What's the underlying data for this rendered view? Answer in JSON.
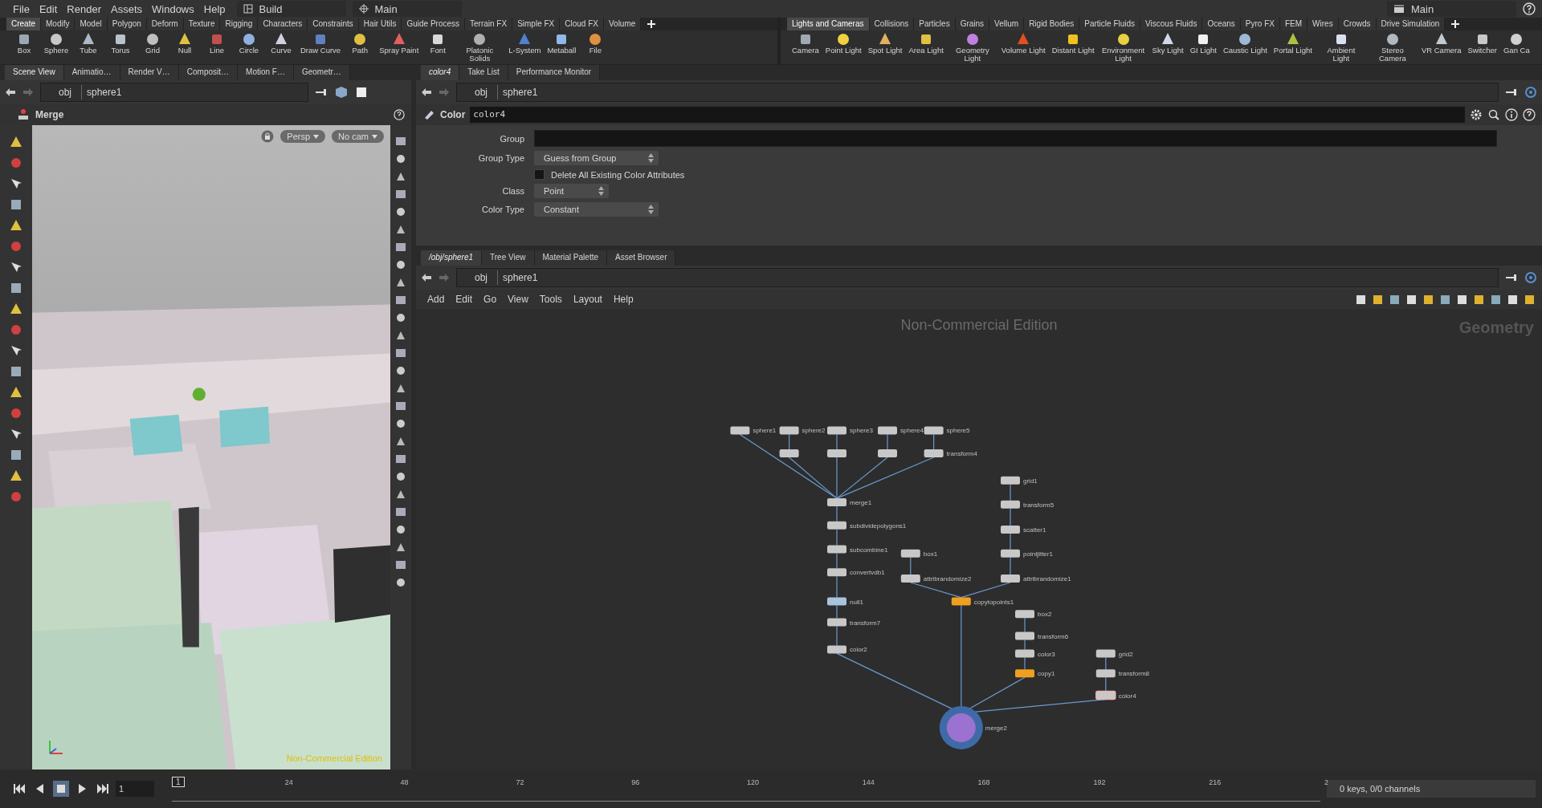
{
  "menu": [
    "File",
    "Edit",
    "Render",
    "Assets",
    "Windows",
    "Help"
  ],
  "desktop": "Build",
  "workspace": "Main",
  "right_workspace": "Main",
  "shelf_left": {
    "tabs": [
      {
        "label": "Create",
        "selected": true
      },
      {
        "label": "Modify",
        "selected": false
      },
      {
        "label": "Model",
        "selected": false
      },
      {
        "label": "Polygon",
        "selected": false
      },
      {
        "label": "Deform",
        "selected": false
      },
      {
        "label": "Texture",
        "selected": false
      },
      {
        "label": "Rigging",
        "selected": false
      },
      {
        "label": "Characters",
        "selected": false
      },
      {
        "label": "Constraints",
        "selected": false
      },
      {
        "label": "Hair Utils",
        "selected": false
      },
      {
        "label": "Guide Process",
        "selected": false
      },
      {
        "label": "Terrain FX",
        "selected": false
      },
      {
        "label": "Simple FX",
        "selected": false
      },
      {
        "label": "Cloud FX",
        "selected": false
      },
      {
        "label": "Volume",
        "selected": false
      }
    ],
    "tools": [
      "Box",
      "Sphere",
      "Tube",
      "Torus",
      "Grid",
      "Null",
      "Line",
      "Circle",
      "Curve",
      "Draw Curve",
      "Path",
      "Spray Paint",
      "Font",
      "Platonic Solids",
      "L-System",
      "Metaball",
      "File"
    ]
  },
  "shelf_right": {
    "tabs": [
      {
        "label": "Lights and Cameras",
        "selected": true
      },
      {
        "label": "Collisions",
        "selected": false
      },
      {
        "label": "Particles",
        "selected": false
      },
      {
        "label": "Grains",
        "selected": false
      },
      {
        "label": "Vellum",
        "selected": false
      },
      {
        "label": "Rigid Bodies",
        "selected": false
      },
      {
        "label": "Particle Fluids",
        "selected": false
      },
      {
        "label": "Viscous Fluids",
        "selected": false
      },
      {
        "label": "Oceans",
        "selected": false
      },
      {
        "label": "Pyro FX",
        "selected": false
      },
      {
        "label": "FEM",
        "selected": false
      },
      {
        "label": "Wires",
        "selected": false
      },
      {
        "label": "Crowds",
        "selected": false
      },
      {
        "label": "Drive Simulation",
        "selected": false
      }
    ],
    "tools": [
      "Camera",
      "Point Light",
      "Spot Light",
      "Area Light",
      "Geometry Light",
      "Volume Light",
      "Distant Light",
      "Environment Light",
      "Sky Light",
      "GI Light",
      "Caustic Light",
      "Portal Light",
      "Ambient Light",
      "Stereo Camera",
      "VR Camera",
      "Switcher",
      "Gan Ca"
    ]
  },
  "scene_pane": {
    "tabs": [
      {
        "label": "Scene View",
        "selected": true
      },
      {
        "label": "Animatio…",
        "selected": false
      },
      {
        "label": "Render V…",
        "selected": false
      },
      {
        "label": "Composit…",
        "selected": false
      },
      {
        "label": "Motion F…",
        "selected": false
      },
      {
        "label": "Geometr…",
        "selected": false
      }
    ],
    "path": [
      "obj",
      "sphere1"
    ],
    "tool": "Merge",
    "view_menu": "Persp",
    "camera_menu": "No cam",
    "watermark": "Non-Commercial Edition"
  },
  "parameter_pane": {
    "tabs": [
      {
        "label": "color4",
        "selected": true
      },
      {
        "label": "Take List",
        "selected": false
      },
      {
        "label": "Performance Monitor",
        "selected": false
      }
    ],
    "path": [
      "obj",
      "sphere1"
    ],
    "node_type": "Color",
    "node_name": "color4",
    "params": [
      {
        "kind": "field",
        "label": "Group"
      },
      {
        "kind": "dropdown",
        "label": "Group Type",
        "value": "Guess from Group"
      },
      {
        "kind": "checkbox",
        "label": "Delete All Existing Color Attributes",
        "checked": false
      },
      {
        "kind": "dropdown",
        "label": "Class",
        "value": "Point"
      },
      {
        "kind": "dropdown",
        "label": "Color Type",
        "value": "Constant"
      }
    ]
  },
  "network_pane": {
    "tabs": [
      {
        "label": "/obj/sphere1",
        "selected": true
      },
      {
        "label": "Tree View",
        "selected": false
      },
      {
        "label": "Material Palette",
        "selected": false
      },
      {
        "label": "Asset Browser",
        "selected": false
      }
    ],
    "path": [
      "obj",
      "sphere1"
    ],
    "menu": [
      "Add",
      "Edit",
      "Go",
      "View",
      "Tools",
      "Layout",
      "Help"
    ],
    "watermark": "Non-Commercial Edition",
    "context": "Geometry",
    "nodes": [
      {
        "name": "sphere1",
        "color": "#c8c8c8",
        "selected": false
      },
      {
        "name": "sphere2",
        "color": "#c8c8c8",
        "selected": false
      },
      {
        "name": "sphere3",
        "color": "#c8c8c8",
        "selected": false
      },
      {
        "name": "sphere4",
        "color": "#c8c8c8",
        "selected": false
      },
      {
        "name": "sphere5",
        "color": "#c8c8c8",
        "selected": false
      },
      {
        "color": "#c8c8c8",
        "selected": false
      },
      {
        "color": "#c8c8c8",
        "selected": false
      },
      {
        "color": "#c8c8c8",
        "selected": false
      },
      {
        "name": "transform4",
        "color": "#c8c8c8",
        "selected": false
      },
      {
        "name": "merge1",
        "color": "#c8c8c8",
        "selected": false
      },
      {
        "name": "subdividepolygons1",
        "color": "#c8c8c8",
        "selected": false
      },
      {
        "name": "subcombine1",
        "color": "#c8c8c8",
        "selected": false
      },
      {
        "name": "convertvdb1",
        "color": "#c8c8c8",
        "selected": false
      },
      {
        "name": "null1",
        "color": "#a9c4dc",
        "selected": false
      },
      {
        "name": "transform7",
        "color": "#c8c8c8",
        "selected": false
      },
      {
        "name": "color2",
        "color": "#c8c8c8",
        "selected": false
      },
      {
        "name": "box1",
        "color": "#c8c8c8",
        "selected": false
      },
      {
        "name": "attribrandomize2",
        "color": "#c8c8c8",
        "selected": false
      },
      {
        "name": "grid1",
        "color": "#c8c8c8",
        "selected": false
      },
      {
        "name": "transform5",
        "color": "#c8c8c8",
        "selected": false
      },
      {
        "name": "scatter1",
        "color": "#c8c8c8",
        "selected": false
      },
      {
        "name": "pointjitter1",
        "color": "#c8c8c8",
        "selected": false
      },
      {
        "name": "attribrandomize1",
        "color": "#c8c8c8",
        "selected": false
      },
      {
        "name": "copytopoints1",
        "color": "#f0a020",
        "selected": false
      },
      {
        "name": "box2",
        "color": "#c8c8c8",
        "selected": false
      },
      {
        "name": "transform6",
        "color": "#c8c8c8",
        "selected": false
      },
      {
        "name": "color3",
        "color": "#c8c8c8",
        "selected": false
      },
      {
        "name": "copy1",
        "color": "#f0a020",
        "selected": false
      },
      {
        "name": "grid2",
        "color": "#c8c8c8",
        "selected": false
      },
      {
        "name": "transform8",
        "color": "#c8c8c8",
        "selected": false
      },
      {
        "name": "color4",
        "color": "#c8c8c8",
        "selected": true
      },
      {
        "name": "merge2",
        "color": "#9b72cf",
        "selected": false
      }
    ]
  },
  "timeline": {
    "frame": "1",
    "current_frame": "1",
    "ticks": [
      "24",
      "48",
      "72",
      "96",
      "120",
      "144",
      "168",
      "192",
      "216",
      "2"
    ],
    "status": "0 keys, 0/0 channels"
  }
}
